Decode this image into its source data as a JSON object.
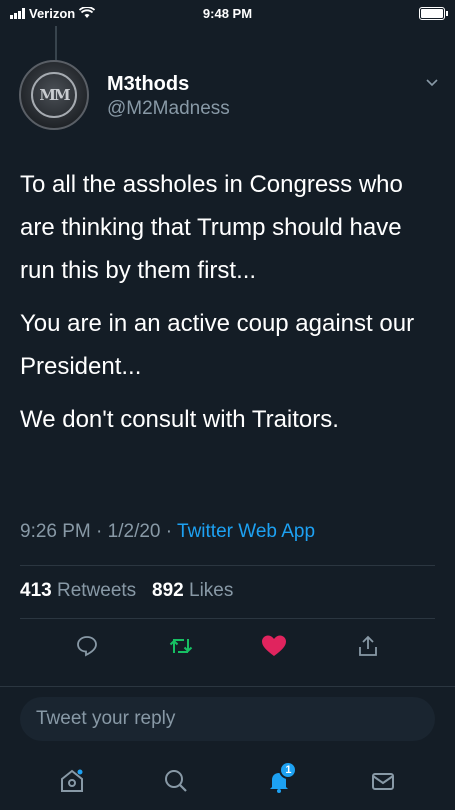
{
  "status_bar": {
    "carrier": "Verizon",
    "time": "9:48 PM"
  },
  "tweet": {
    "display_name": "M3thods",
    "handle": "@M2Madness",
    "avatar_text": "MM",
    "paragraphs": [
      "To all the assholes in Congress who are thinking that Trump should have run this by them first...",
      "You are in an active coup against our President...",
      "We don't consult with Traitors."
    ],
    "time": "9:26 PM",
    "date": "1/2/20",
    "source": "Twitter Web App",
    "retweets_count": "413",
    "retweets_label": "Retweets",
    "likes_count": "892",
    "likes_label": "Likes"
  },
  "reply": {
    "placeholder": "Tweet your reply"
  },
  "tabbar": {
    "notifications_badge": "1"
  },
  "colors": {
    "background": "#141d26",
    "accent": "#1da1f2",
    "like": "#e0245e",
    "retweet": "#17bf63"
  }
}
